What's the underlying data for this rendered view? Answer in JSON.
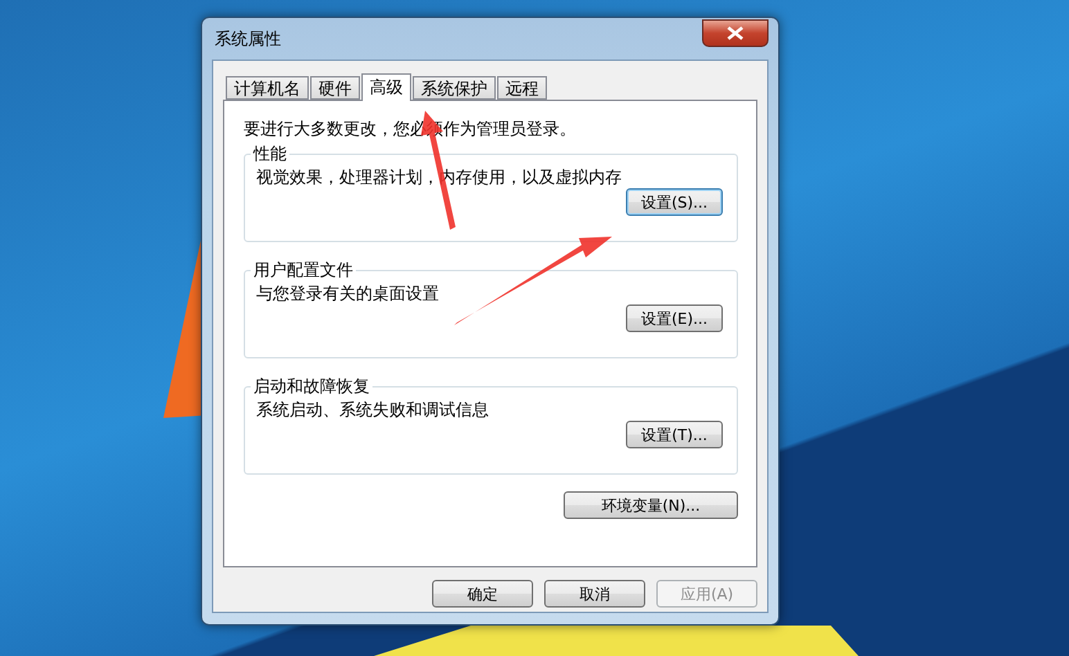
{
  "window": {
    "title": "系统属性"
  },
  "tabs": [
    {
      "label": "计算机名",
      "selected": false
    },
    {
      "label": "硬件",
      "selected": false
    },
    {
      "label": "高级",
      "selected": true
    },
    {
      "label": "系统保护",
      "selected": false
    },
    {
      "label": "远程",
      "selected": false
    }
  ],
  "note": "要进行大多数更改，您必须作为管理员登录。",
  "groups": [
    {
      "title": "性能",
      "description": "视觉效果，处理器计划，内存使用，以及虚拟内存",
      "button": {
        "label": "设置(S)...",
        "focused": true
      }
    },
    {
      "title": "用户配置文件",
      "description": "与您登录有关的桌面设置",
      "button": {
        "label": "设置(E)...",
        "focused": false
      }
    },
    {
      "title": "启动和故障恢复",
      "description": "系统启动、系统失败和调试信息",
      "button": {
        "label": "设置(T)...",
        "focused": false
      }
    }
  ],
  "env_button": {
    "label": "环境变量(N)..."
  },
  "footer_buttons": [
    {
      "label": "确定",
      "disabled": false
    },
    {
      "label": "取消",
      "disabled": false
    },
    {
      "label": "应用(A)",
      "disabled": true
    }
  ]
}
